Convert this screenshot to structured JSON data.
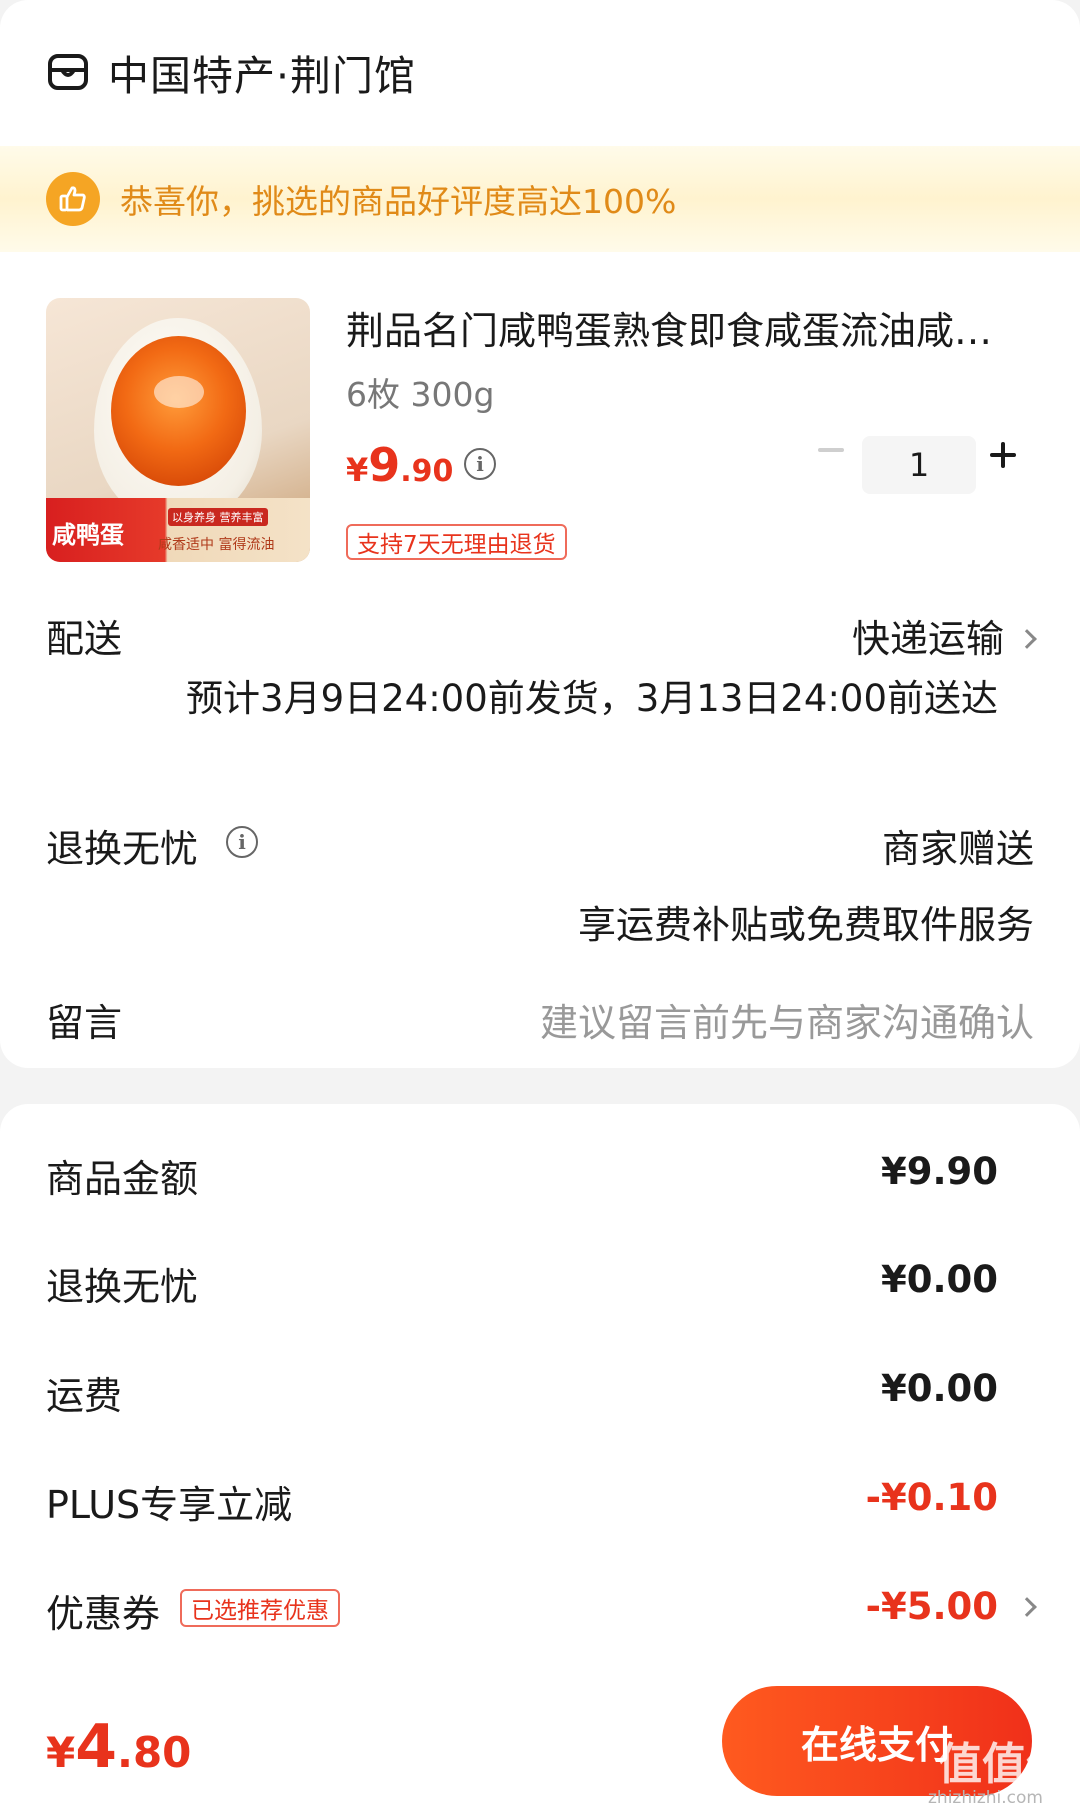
{
  "store": {
    "name": "中国特产·荆门馆",
    "icon": "store-icon"
  },
  "banner": {
    "icon": "thumbs-up-icon",
    "text": "恭喜你，挑选的商品好评度高达100%",
    "color": "#e08a18"
  },
  "product": {
    "image_label_main": "咸鸭蛋",
    "image_label_tag": "以身养身 营养丰富",
    "image_label_sub": "咸香适中 富得流油",
    "title": "荆品名门咸鸭蛋熟食即食咸蛋流油咸…",
    "spec": "6枚 300g",
    "price_yen": "¥",
    "price_int": "9",
    "price_dec": ".90",
    "price_info_icon": "info-icon",
    "quantity": "1",
    "return_tag": "支持7天无理由退货"
  },
  "delivery": {
    "label": "配送",
    "method": "快递运输",
    "eta": "预计3月9日24:00前发货，3月13日24:00前送达"
  },
  "worry_free": {
    "label": "退换无忧",
    "value": "商家赠送",
    "subsidy": "享运费补贴或免费取件服务"
  },
  "message": {
    "label": "留言",
    "placeholder": "建议留言前先与商家沟通确认"
  },
  "fees": [
    {
      "label": "商品金额",
      "value": "¥9.90"
    },
    {
      "label": "退换无忧",
      "value": "¥0.00"
    },
    {
      "label": "运费",
      "value": "¥0.00"
    },
    {
      "label": "PLUS专享立减",
      "value": "-¥0.10"
    },
    {
      "label": "优惠券",
      "value": "-¥5.00",
      "tag": "已选推荐优惠"
    }
  ],
  "footer": {
    "total_yen": "¥",
    "total_int": "4",
    "total_dec": ".80",
    "pay_label": "在线支付"
  },
  "watermark": {
    "glyph": "值值值",
    "text": "zhizhizhi.com"
  },
  "colors": {
    "accent": "#e8331c",
    "banner_orange": "#f5a524"
  }
}
